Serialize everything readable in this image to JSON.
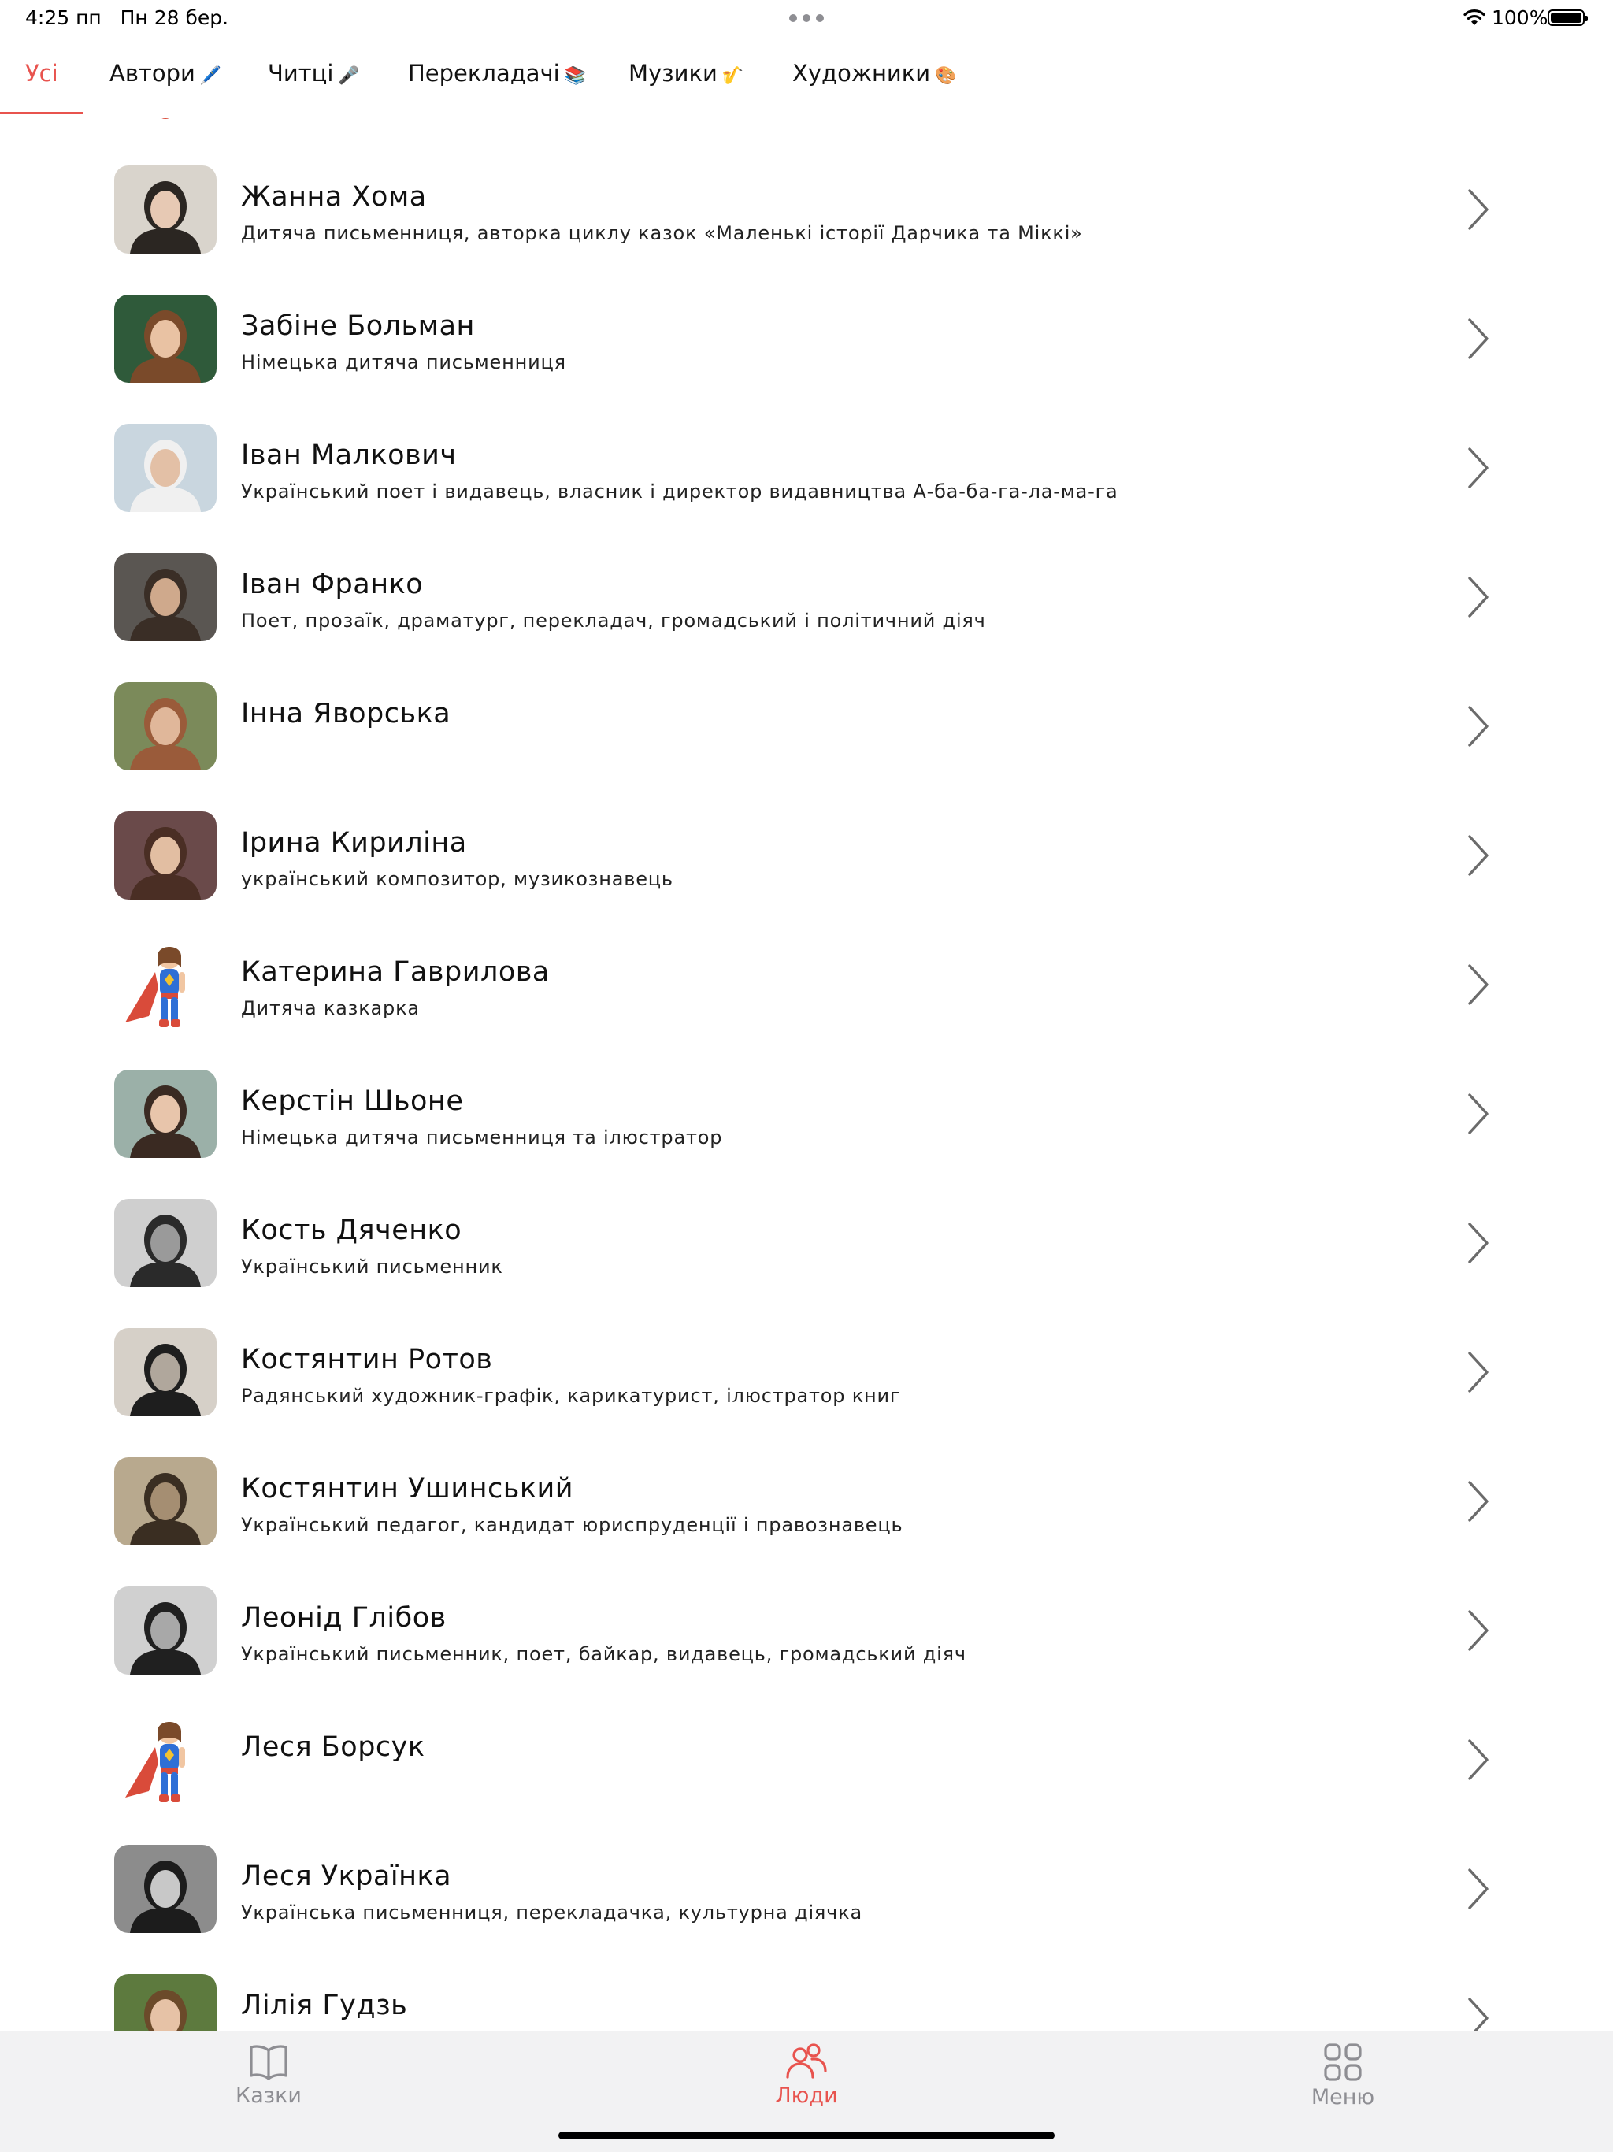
{
  "status_bar": {
    "time": "4:25 пп",
    "date": "Пн 28 бер.",
    "battery": "100%"
  },
  "tabs": [
    {
      "label": "Усі",
      "emoji": ""
    },
    {
      "label": "Автори",
      "emoji": "🖊️"
    },
    {
      "label": "Читці",
      "emoji": "🎤"
    },
    {
      "label": "Перекладачі",
      "emoji": "📚"
    },
    {
      "label": "Музики",
      "emoji": "🎷"
    },
    {
      "label": "Художники",
      "emoji": "🎨"
    }
  ],
  "people": [
    {
      "name": "Жанна Хома",
      "description": "Дитяча письменниця, авторка циклу казок «Маленькі історії Дарчика та Міккі»",
      "avatar": "photo"
    },
    {
      "name": "Забіне Больман",
      "description": "Німецька дитяча письменниця",
      "avatar": "photo"
    },
    {
      "name": "Іван Малкович",
      "description": "Український поет і видавець, власник і директор видавництва А-ба-ба-га-ла-ма-га",
      "avatar": "photo"
    },
    {
      "name": "Іван Франко",
      "description": "Поет, прозаїк, драматург, перекладач, громадський і політичний діяч",
      "avatar": "photo"
    },
    {
      "name": "Інна Яворська",
      "description": "",
      "avatar": "photo"
    },
    {
      "name": "Ірина Кириліна",
      "description": "український композитор, музикознавець",
      "avatar": "photo"
    },
    {
      "name": "Катерина Гаврилова",
      "description": "Дитяча казкарка",
      "avatar": "superhero"
    },
    {
      "name": "Керстін Шьоне",
      "description": "Німецька дитяча письменниця та ілюстратор",
      "avatar": "photo"
    },
    {
      "name": "Кость Дяченко",
      "description": "Український письменник",
      "avatar": "photo"
    },
    {
      "name": "Костянтин Ротов",
      "description": "Радянський художник-графік, карикатурист, ілюстратор книг",
      "avatar": "photo"
    },
    {
      "name": "Костянтин Ушинський",
      "description": "Український педагог, кандидат юриспруденції і правознавець",
      "avatar": "photo"
    },
    {
      "name": "Леонід Глібов",
      "description": "Український письменник, поет, байкар, видавець, громадський діяч",
      "avatar": "photo"
    },
    {
      "name": "Леся Борсук",
      "description": "",
      "avatar": "superhero"
    },
    {
      "name": "Леся Українка",
      "description": "Українська письменниця, перекладачка, культурна діячка",
      "avatar": "photo"
    },
    {
      "name": "Лілія Гудзь",
      "description": "",
      "avatar": "photo"
    }
  ],
  "bottom_tabs": [
    {
      "label": "Казки",
      "icon": "book-icon",
      "active": false
    },
    {
      "label": "Люди",
      "icon": "people-icon",
      "active": true
    },
    {
      "label": "Меню",
      "icon": "grid-icon",
      "active": false
    }
  ],
  "colors": {
    "accent": "#e8534e",
    "inactive": "#8e8e93",
    "tabbar_bg": "#f2f2f3"
  }
}
